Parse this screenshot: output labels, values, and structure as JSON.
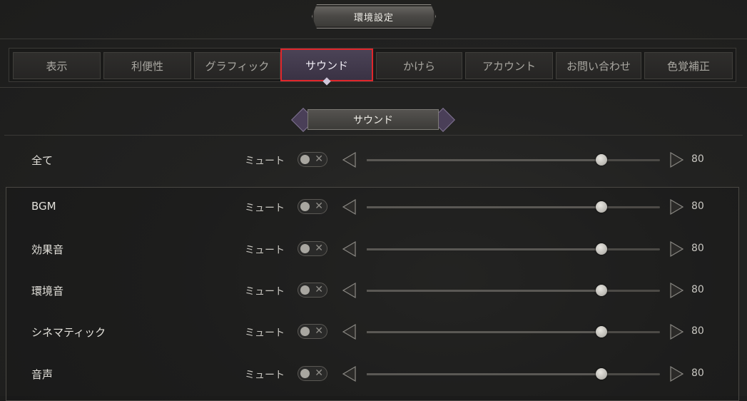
{
  "window": {
    "title": "環境設定"
  },
  "tabs": [
    {
      "label": "表示",
      "active": false
    },
    {
      "label": "利便性",
      "active": false
    },
    {
      "label": "グラフィック",
      "active": false
    },
    {
      "label": "サウンド",
      "active": true
    },
    {
      "label": "かけら",
      "active": false
    },
    {
      "label": "アカウント",
      "active": false
    },
    {
      "label": "お問い合わせ",
      "active": false
    },
    {
      "label": "色覚補正",
      "active": false
    }
  ],
  "section": {
    "title": "サウンド"
  },
  "rows": [
    {
      "label": "全て",
      "mute_label": "ミュート",
      "muted": false,
      "value": "80",
      "level": 0.8
    },
    {
      "label": "BGM",
      "mute_label": "ミュート",
      "muted": false,
      "value": "80",
      "level": 0.8
    },
    {
      "label": "効果音",
      "mute_label": "ミュート",
      "muted": false,
      "value": "80",
      "level": 0.8
    },
    {
      "label": "環境音",
      "mute_label": "ミュート",
      "muted": false,
      "value": "80",
      "level": 0.8
    },
    {
      "label": "シネマティック",
      "mute_label": "ミュート",
      "muted": false,
      "value": "80",
      "level": 0.8
    },
    {
      "label": "音声",
      "mute_label": "ミュート",
      "muted": false,
      "value": "80",
      "level": 0.8
    }
  ],
  "colors": {
    "active_tab_outline": "#e0262b",
    "active_tab_bg": "#40374b"
  },
  "icons": {
    "toggle_off": "x-icon",
    "decrease": "triangle-left-icon",
    "increase": "triangle-right-icon"
  }
}
